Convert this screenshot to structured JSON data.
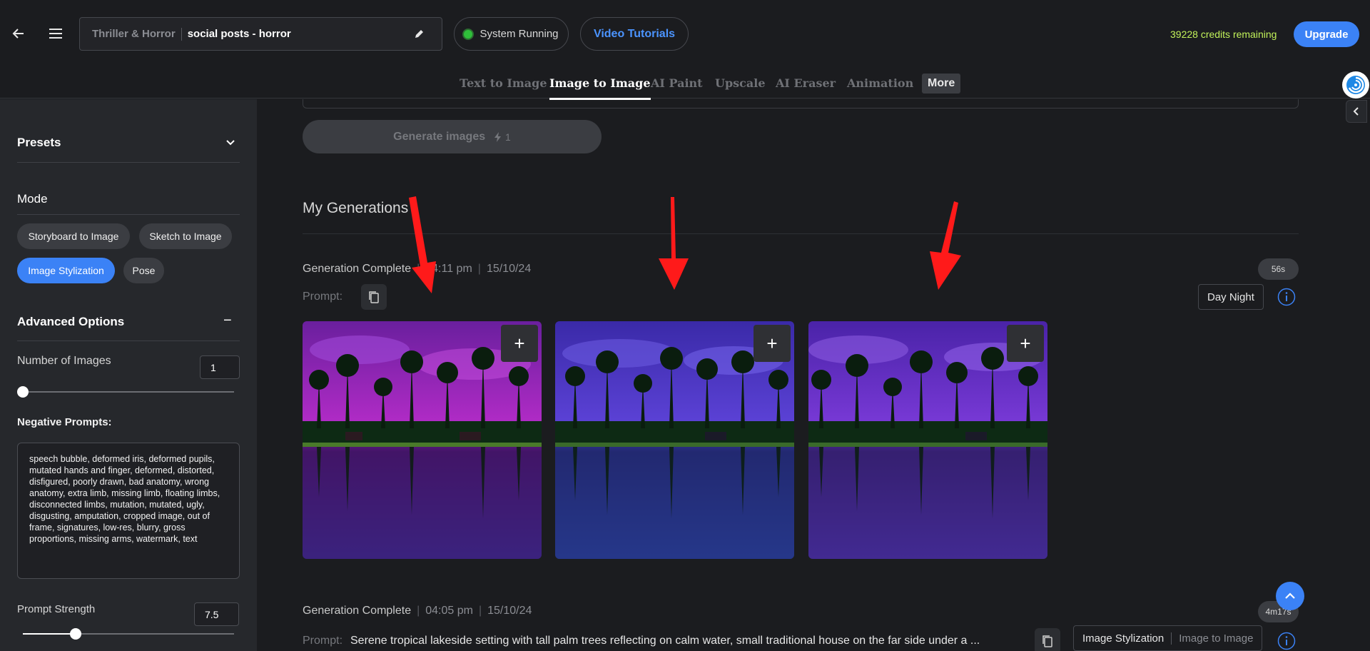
{
  "header": {
    "project_category": "Thriller & Horror",
    "project_name": "social posts - horror",
    "system_status": "System Running",
    "video_tutorials": "Video Tutorials",
    "credits": "39228 credits remaining",
    "upgrade": "Upgrade"
  },
  "tabs": [
    {
      "label": "Text to Image"
    },
    {
      "label": "Image to Image"
    },
    {
      "label": "AI Paint"
    },
    {
      "label": "Upscale"
    },
    {
      "label": "AI Eraser"
    },
    {
      "label": "Animation"
    },
    {
      "label": "More"
    }
  ],
  "sidebar": {
    "presets": "Presets",
    "mode": "Mode",
    "modes": [
      "Storyboard to Image",
      "Sketch to Image",
      "Image Stylization",
      "Pose"
    ],
    "active_mode": "Image Stylization",
    "advanced": "Advanced Options",
    "advanced_toggle": "−",
    "num_images_label": "Number of Images",
    "num_images": "1",
    "num_images_slider": 0,
    "negative_label": "Negative Prompts:",
    "negative_text": "speech bubble, deformed iris, deformed pupils, mutated hands and finger, deformed, distorted, disfigured, poorly drawn, bad anatomy, wrong anatomy, extra limb, missing limb, floating limbs, disconnected limbs, mutation, mutated, ugly, disgusting, amputation, cropped image, out of frame, signatures, low-res, blurry, gross proportions, missing arms, watermark, text",
    "prompt_strength_label": "Prompt Strength",
    "prompt_strength": "7.5",
    "prompt_strength_slider": 0.25
  },
  "main": {
    "generate": "Generate images",
    "generate_cost": "1",
    "my_generations": "My Generations",
    "gen1": {
      "status": "Generation Complete",
      "time": "04:11 pm",
      "date": "15/10/24",
      "duration": "56s",
      "prompt_label": "Prompt:",
      "tag": "Day Night"
    },
    "gen2": {
      "status": "Generation Complete",
      "time": "04:05 pm",
      "date": "15/10/24",
      "duration": "4m17s",
      "prompt_label": "Prompt:",
      "prompt": "Serene tropical lakeside setting with tall palm trees reflecting on calm water, small traditional house on the far side under a ...",
      "tag1": "Image Stylization",
      "tag2": "Image to Image"
    }
  },
  "colors": {
    "accent": "#3b82f6",
    "credits": "#c2f25a",
    "status_dot": "#2fbf3a",
    "annotation_arrow": "#ff1a1a"
  }
}
